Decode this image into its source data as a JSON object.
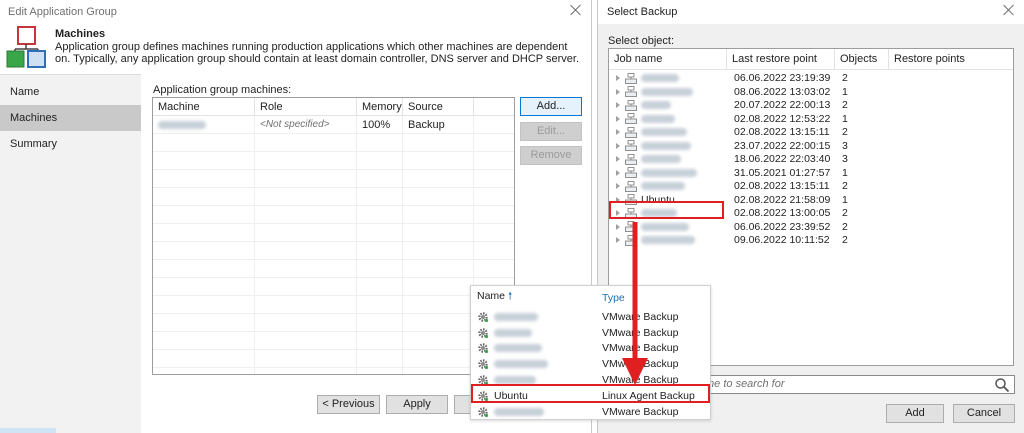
{
  "edit_window": {
    "title": "Edit Application Group",
    "header_title": "Machines",
    "header_desc": "Application group defines machines running production applications which other machines are dependent on. Typically, any application group should contain at least domain controller, DNS server and DHCP server.",
    "nav": [
      {
        "label": "Name"
      },
      {
        "label": "Machines"
      },
      {
        "label": "Summary"
      }
    ],
    "grid_label": "Application group machines:",
    "columns": [
      "Machine",
      "Role",
      "Memory",
      "Source"
    ],
    "rows": [
      {
        "machine": "",
        "role": "<Not specified>",
        "memory": "100%",
        "source": "Backup"
      }
    ],
    "buttons": {
      "add": "Add...",
      "edit": "Edit...",
      "remove": "Remove"
    },
    "bottom": {
      "previous": "< Previous",
      "apply": "Apply"
    }
  },
  "select_window": {
    "title": "Select Backup",
    "select_label": "Select object:",
    "columns": [
      "Job name",
      "Last restore point",
      "Objects",
      "Restore points"
    ],
    "rows": [
      {
        "name": "",
        "last": "06.06.2022 23:19:39",
        "objects": "2"
      },
      {
        "name": "",
        "last": "08.06.2022 13:03:02",
        "objects": "1"
      },
      {
        "name": "",
        "last": "20.07.2022 22:00:13",
        "objects": "2"
      },
      {
        "name": "",
        "last": "02.08.2022 12:53:22",
        "objects": "1"
      },
      {
        "name": "",
        "last": "02.08.2022 13:15:11",
        "objects": "2"
      },
      {
        "name": "",
        "last": "23.07.2022 22:00:15",
        "objects": "3"
      },
      {
        "name": "",
        "last": "18.06.2022 22:03:40",
        "objects": "3"
      },
      {
        "name": "",
        "last": "31.05.2021 01:27:57",
        "objects": "1"
      },
      {
        "name": "",
        "last": "02.08.2022 13:15:11",
        "objects": "2"
      },
      {
        "name": "Ubuntu",
        "last": "02.08.2022 21:58:09",
        "objects": "1"
      },
      {
        "name": "",
        "last": "02.08.2022 13:00:05",
        "objects": "2"
      },
      {
        "name": "",
        "last": "06.06.2022 23:39:52",
        "objects": "2"
      },
      {
        "name": "",
        "last": "09.06.2022 10:11:52",
        "objects": "2"
      }
    ],
    "search_placeholder": "me to search for",
    "buttons": {
      "add": "Add",
      "cancel": "Cancel"
    }
  },
  "popup": {
    "col_name": "Name",
    "col_type": "Type",
    "sort_arrow": "🠕",
    "rows": [
      {
        "name": "",
        "type": "VMware Backup"
      },
      {
        "name": "",
        "type": "VMware Backup"
      },
      {
        "name": "",
        "type": "VMware Backup"
      },
      {
        "name": "",
        "type": "VMware Backup"
      },
      {
        "name": "",
        "type": "VMware Backup"
      },
      {
        "name": "Ubuntu",
        "type": "Linux Agent Backup"
      },
      {
        "name": "",
        "type": "VMware Backup"
      }
    ]
  },
  "colors": {
    "highlight": "#e02020",
    "selected_nav": "#c9c9c9",
    "type_header": "#1f6fb5"
  }
}
